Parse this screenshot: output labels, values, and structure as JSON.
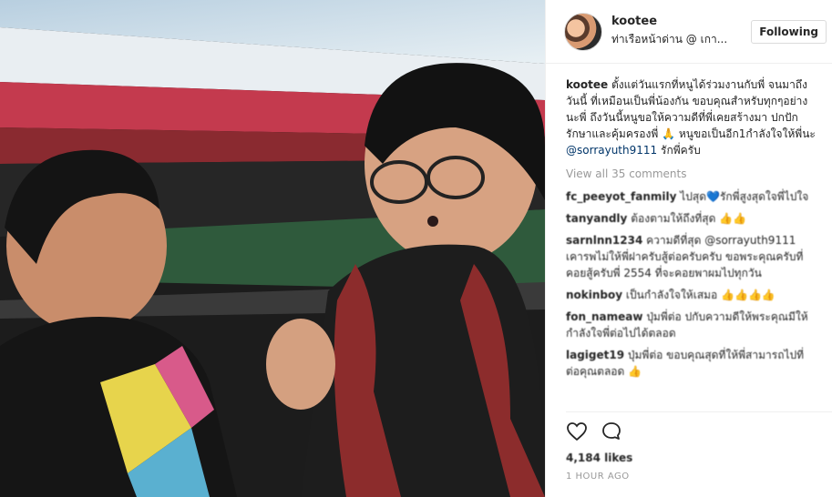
{
  "post": {
    "username": "kootee",
    "location": "ท่าเรือหน้าด่าน @ เกา...",
    "follow_label": "Following",
    "caption_text": "ตั้งแต่วันแรกที่หนูได้ร่วมงานกับพี่ จนมาถึงวันนี้ ที่เหมือนเป็นพี่น้องกัน ขอบคุณสำหรับทุกๆอย่างนะพี่ ถึงวันนี้หนูขอให้ความดีที่พี่เคยสร้างมา ปกปักรักษาและคุ้มครองพี่ 🙏 หนูขอเป็นอีก1กำลังใจให้พี่นะ",
    "caption_mention": "@sorrayuth9111",
    "caption_tail": "รักพี่ครับ",
    "view_all": "View all 35 comments",
    "likes": "4,184 likes",
    "time": "1 HOUR AGO"
  },
  "comments": [
    {
      "user": "fc_peeyot_fanmily",
      "text": "ไปสุด💙รักพี่สูงสุดใจพี่ไปใจ"
    },
    {
      "user": "tanyandly",
      "text": "ต้องตามให้ถึงที่สุด 👍👍"
    },
    {
      "user": "sarnlnn1234",
      "text": "ความดีที่สุด @sorrayuth9111 เคารพไม่ให้พี่ฝาครับสู้ต่อครับครับ ขอพระคุณครับที่คอยสู้ครับพี่ 2554 ที่จะคอยพาผมไปทุกวัน"
    },
    {
      "user": "nokinboy",
      "text": "เป็นกำลังใจให้เสมอ 👍👍👍👍"
    },
    {
      "user": "fon_nameaw",
      "text": "ปุ่มพี่ต่อ ปกับความดีให้พระคุณมีให้กำลังใจพี่ต่อไปได้ตลอด"
    },
    {
      "user": "lagiget19",
      "text": "ปุ่มพี่ต่อ ขอบคุณสุดที่ให้พี่สามารถไปที่ต่อคุณตลอด 👍"
    }
  ],
  "icons": {
    "like": "heart-outline-icon",
    "comment": "speech-bubble-icon"
  }
}
